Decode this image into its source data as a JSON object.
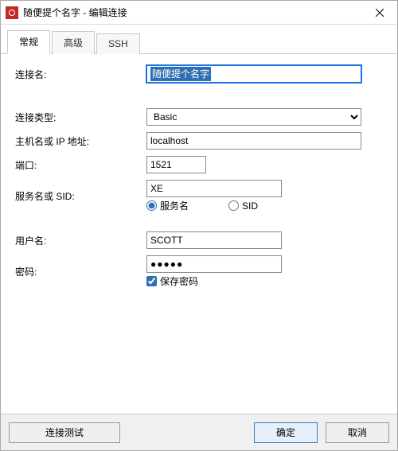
{
  "window": {
    "title": "随便提个名字 - 编辑连接"
  },
  "tabs": {
    "general": "常规",
    "advanced": "高级",
    "ssh": "SSH",
    "active": "general"
  },
  "labels": {
    "connection_name": "连接名:",
    "connection_type": "连接类型:",
    "host": "主机名或 IP 地址:",
    "port": "端口:",
    "service_or_sid": "服务名或 SID:",
    "username": "用户名:",
    "password": "密码:"
  },
  "values": {
    "connection_name": "随便提个名字",
    "connection_type": "Basic",
    "host": "localhost",
    "port": "1521",
    "service_or_sid": "XE",
    "username": "SCOTT",
    "password_display": "●●●●●"
  },
  "radio": {
    "service_name": "服务名",
    "sid": "SID",
    "selected": "service_name"
  },
  "checkbox": {
    "save_password": "保存密码",
    "checked": true
  },
  "buttons": {
    "test": "连接测试",
    "ok": "确定",
    "cancel": "取消"
  }
}
